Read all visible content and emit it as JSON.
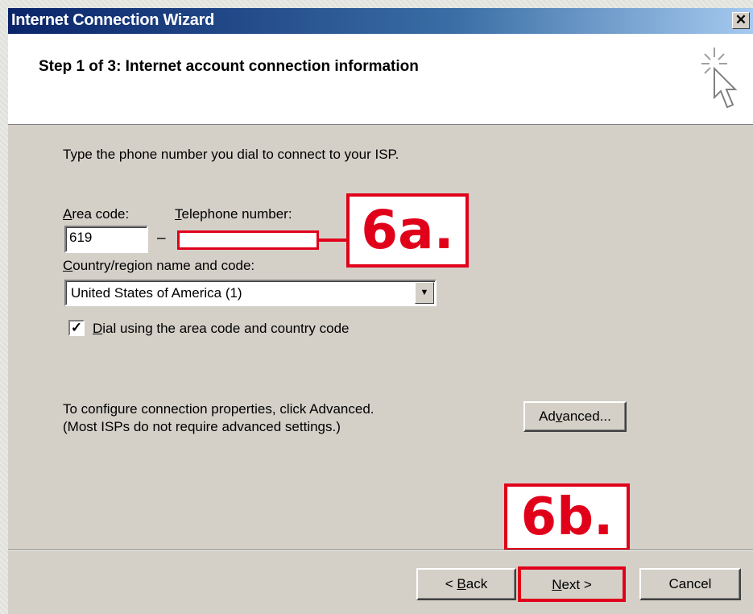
{
  "window": {
    "title": "Internet Connection Wizard"
  },
  "header": {
    "step_title": "Step 1 of 3: Internet account connection information"
  },
  "body": {
    "intro": "Type the phone number you dial to connect to your ISP.",
    "area_code_label": "Area code:",
    "telephone_label": "Telephone number:",
    "area_code_value": "619",
    "dash": "–",
    "telephone_value": "",
    "country_label": "Country/region name and code:",
    "country_value": "United States of America (1)",
    "dial_label": "Dial using the area code and country code",
    "dial_checked": true,
    "configure_line1": "To configure connection properties, click Advanced.",
    "configure_line2": "(Most ISPs do not require advanced settings.)",
    "advanced_label": "Advanced..."
  },
  "footer": {
    "back_label": "< Back",
    "next_label": "Next >",
    "cancel_label": "Cancel"
  },
  "callouts": {
    "a": "6a.",
    "b": "6b."
  },
  "colors": {
    "callout_red": "#e1001a",
    "title_bar": "#0a246a",
    "dialog_bg": "#d4d0c8"
  },
  "icons": {
    "wizard": "sparkle-cursor-icon",
    "close": "close-icon",
    "dropdown": "chevron-down-icon",
    "check": "checkmark-icon"
  }
}
